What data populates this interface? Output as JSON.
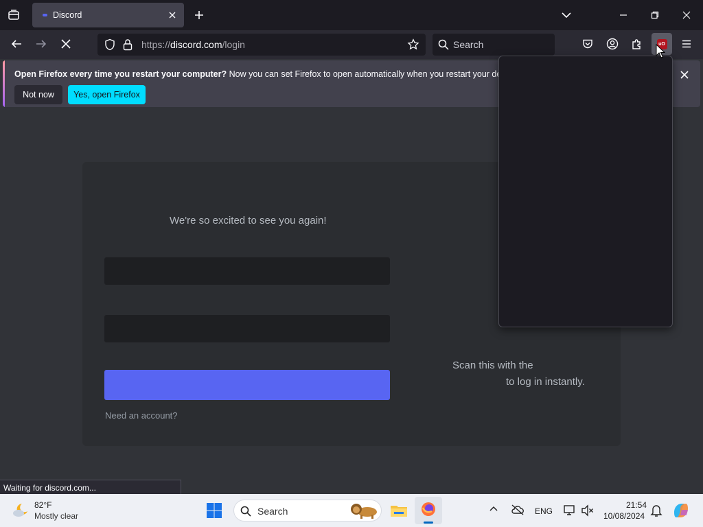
{
  "browser": {
    "tab": {
      "title": "Discord"
    },
    "url": {
      "scheme": "https://",
      "host": "discord.com",
      "path": "/login"
    },
    "search_placeholder": "Search",
    "extension_badge": "uO"
  },
  "notification": {
    "bold_text": "Open Firefox every time you restart your computer?",
    "text": " Now you can set Firefox to open automatically when you restart your device.",
    "not_now_label": "Not now",
    "yes_label": "Yes, open Firefox"
  },
  "page": {
    "subtitle": "We're so excited to see you again!",
    "need_account": "Need an account?",
    "qr_text_line1": "Scan this with the",
    "qr_text_line2": "to log in instantly."
  },
  "status_text": "Waiting for discord.com...",
  "taskbar": {
    "weather_temp": "82°F",
    "weather_desc": "Mostly clear",
    "search_label": "Search",
    "language": "ENG",
    "time": "21:54",
    "date": "10/08/2024"
  },
  "colors": {
    "discord_blurple": "#5865f2",
    "firefox_accent": "#00ddff"
  }
}
